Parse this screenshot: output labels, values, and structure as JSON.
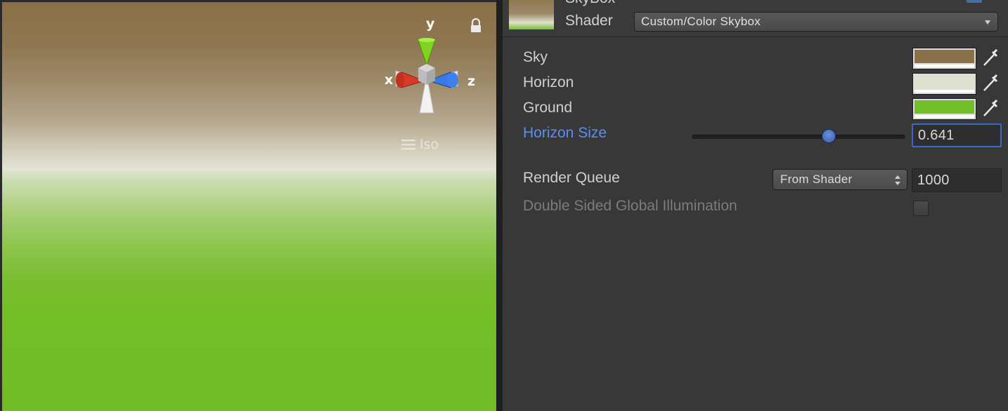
{
  "scene_view": {
    "gizmo_axes": {
      "x": "x",
      "y": "y",
      "z": "z"
    },
    "projection_label": "Iso",
    "icons": [
      "lock-icon",
      "menu-icon"
    ]
  },
  "inspector": {
    "material_name": "SkyBox",
    "shader": {
      "label": "Shader",
      "value": "Custom/Color Skybox"
    },
    "properties": {
      "sky": {
        "label": "Sky",
        "color": "#8a7046"
      },
      "horizon": {
        "label": "Horizon",
        "color": "#dde1cd"
      },
      "ground": {
        "label": "Ground",
        "color": "#72be28"
      },
      "horizon_size": {
        "label": "Horizon Size",
        "value": "0.641",
        "slider_fraction": 0.641
      }
    },
    "render_queue": {
      "label": "Render Queue",
      "mode": "From Shader",
      "value": "1000"
    },
    "double_sided_gi": {
      "label": "Double Sided Global Illumination",
      "checked": false
    }
  },
  "colors": {
    "accent": "#5b8ff0",
    "panel_bg": "#383838"
  }
}
